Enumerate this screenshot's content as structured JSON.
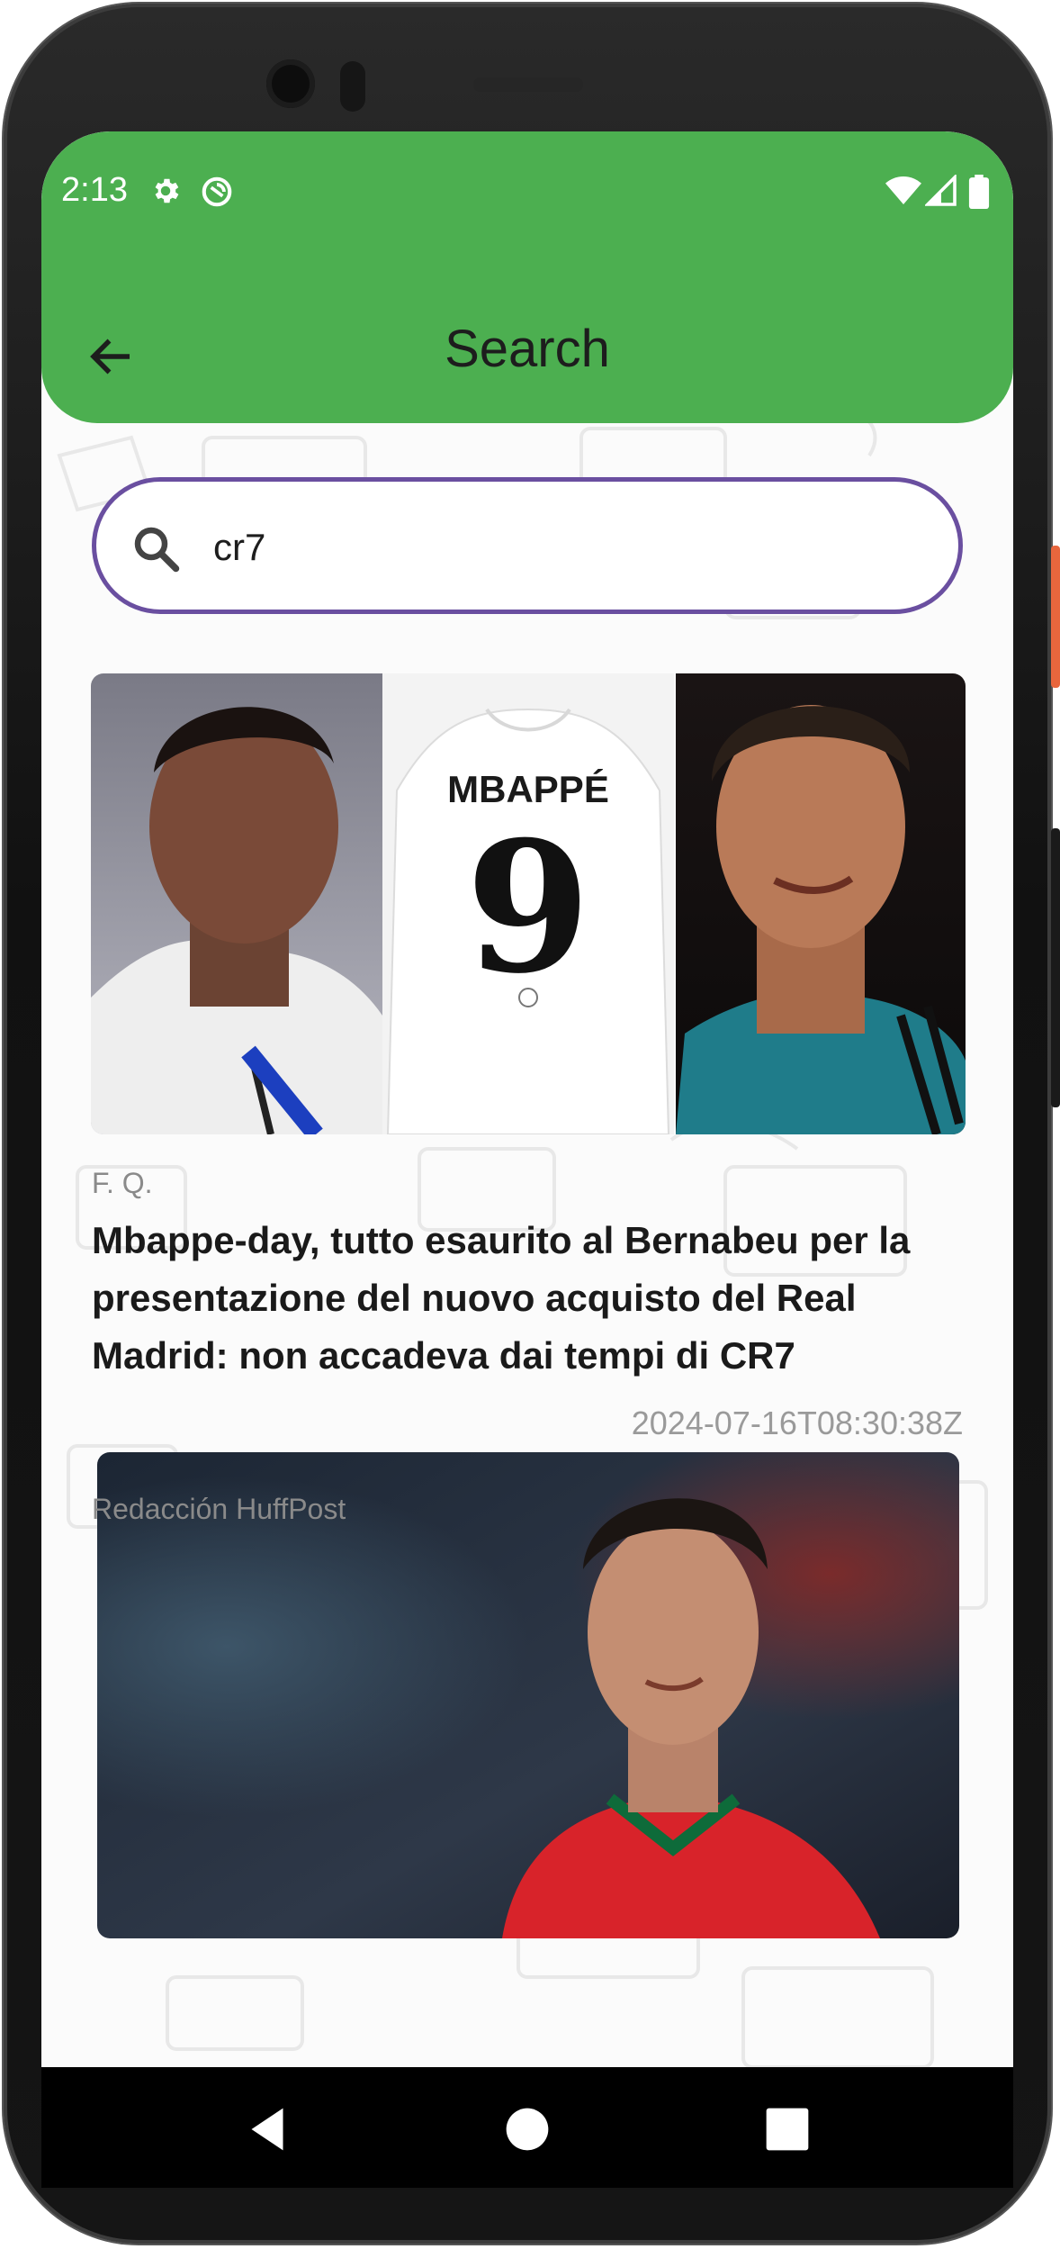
{
  "status_bar": {
    "time": "2:13",
    "left_icons": [
      "settings-icon",
      "sync-icon"
    ],
    "right_icons": [
      "wifi-icon",
      "signal-icon",
      "battery-icon"
    ]
  },
  "app_bar": {
    "title": "Search",
    "back_icon": "arrow-back-icon",
    "color": "#4caf50"
  },
  "search": {
    "value": "cr7",
    "icon": "search-icon",
    "border_color": "#6a4fa0"
  },
  "articles": [
    {
      "image": "Mbappé photo, white shirt with MBAPPÉ 9, Cristiano Ronaldo photo",
      "shirt_name": "MBAPPÉ",
      "shirt_number": "9",
      "author": "F. Q.",
      "title": "Mbappe-day, tutto esaurito al Bernabeu per la presentazione del nuovo acquisto del Real Madrid: non accadeva dai tempi di CR7",
      "date": "2024-07-16T08:30:38Z"
    },
    {
      "image": "Cristiano Ronaldo in red Portugal shirt",
      "author": "Redacción HuffPost"
    }
  ],
  "nav_bar": {
    "buttons": [
      "back-triangle-icon",
      "home-circle-icon",
      "recents-square-icon"
    ]
  }
}
